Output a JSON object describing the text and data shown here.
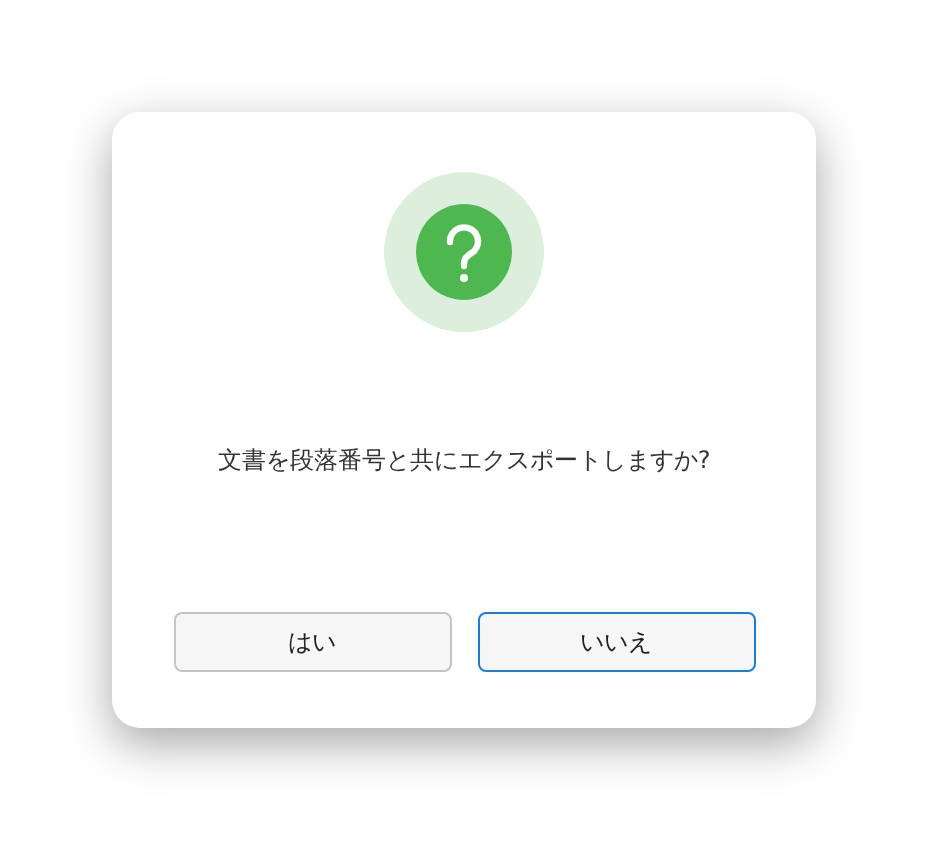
{
  "dialog": {
    "message": "文書を段落番号と共にエクスポートしますか?",
    "buttons": [
      {
        "label": "はい",
        "focused": false
      },
      {
        "label": "いいえ",
        "focused": true
      }
    ]
  }
}
